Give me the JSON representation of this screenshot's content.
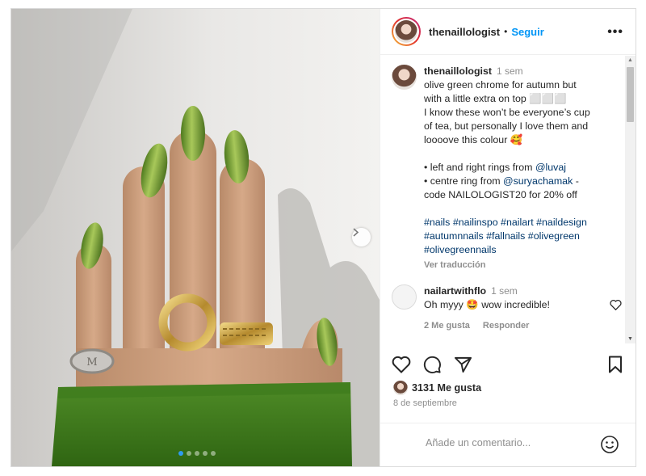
{
  "header": {
    "username": "thenaillologist",
    "dot": "•",
    "follow_label": "Seguir",
    "more_icon": "more-horizontal-icon"
  },
  "caption": {
    "username": "thenaillologist",
    "time": "1 sem",
    "line1": "olive green chrome for autumn but",
    "line2": "with a little extra on top ⬜⬜⬜",
    "line3": "I know these won’t be everyone’s cup",
    "line4": "of tea, but personally I love them and",
    "line5_text": "loooove this colour ",
    "line5_emoji": "🥰",
    "rings1_prefix": "• left and right rings from ",
    "rings1_mention": "@luvaj",
    "rings2_prefix": "• centre ring from ",
    "rings2_mention": "@suryachamak",
    "rings2_suffix": " -",
    "code_line": "code NAILOLOGIST20 for 20% off",
    "hashtags_line1": "#nails #nailinspo #nailart #naildesign",
    "hashtags_line2": "#autumnnails #fallnails #olivegreen",
    "hashtags_line3": "#olivegreennails",
    "translate_label": "Ver traducción"
  },
  "comment": {
    "username": "nailartwithflo",
    "time": "1 sem",
    "text_before": "Oh myyy ",
    "emoji": "🤩",
    "text_after": " wow incredible!",
    "likes_label": "2 Me gusta",
    "reply_label": "Responder"
  },
  "actions": {
    "icons": [
      "heart-icon",
      "comment-icon",
      "share-icon",
      "bookmark-icon"
    ]
  },
  "likes": {
    "count_label": "3131 Me gusta"
  },
  "date": "8 de septiembre",
  "add_comment": {
    "placeholder": "Añade un comentario...",
    "emoji_icon": "smiley-icon"
  },
  "carousel": {
    "slides": 5,
    "active_slide": 1
  },
  "colors": {
    "link_blue": "#0095f6",
    "mention_blue": "#00376b",
    "muted_gray": "#8e8e8e",
    "border": "#dbdbdb",
    "nail_green": "#6f9a33",
    "sleeve_green": "#3f7a20"
  }
}
